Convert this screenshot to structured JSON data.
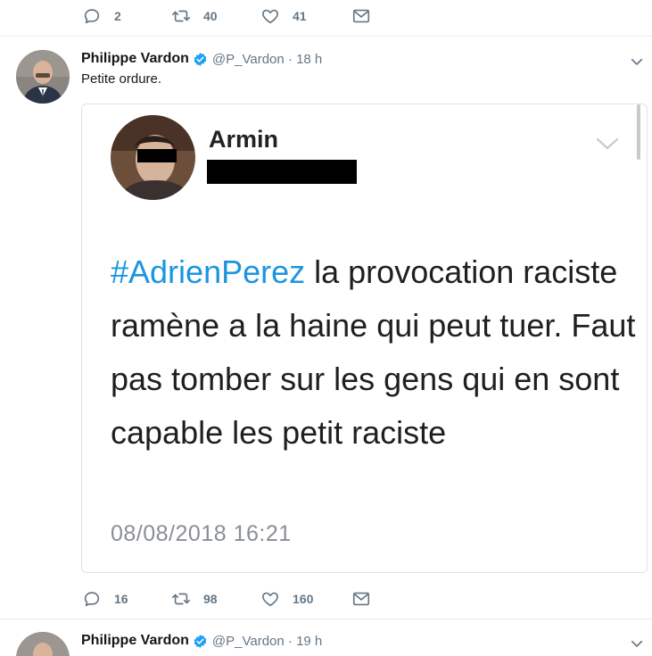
{
  "top_actions": {
    "reply_count": "2",
    "retweet_count": "40",
    "like_count": "41"
  },
  "tweet": {
    "author_name": "Philippe Vardon",
    "handle_time": "@P_Vardon · 18 h",
    "text": "Petite ordure.",
    "embedded": {
      "name": "Armin",
      "hashtag": "#AdrienPerez",
      "body": " la provocation raciste ramène a la haine qui peut tuer. Faut pas tomber sur les gens qui en sont capable les petit raciste",
      "date": "08/08/2018 16:21"
    },
    "actions": {
      "reply_count": "16",
      "retweet_count": "98",
      "like_count": "160"
    }
  },
  "next_tweet": {
    "author_name": "Philippe Vardon",
    "handle_time": "@P_Vardon · 19 h"
  },
  "colors": {
    "accent": "#1b95e0",
    "verified": "#1da1f2",
    "muted": "#657786",
    "divider": "#e6ecf0"
  },
  "icons": [
    "reply-icon",
    "retweet-icon",
    "like-icon",
    "dm-icon",
    "verified-icon",
    "chevron-down-icon"
  ]
}
